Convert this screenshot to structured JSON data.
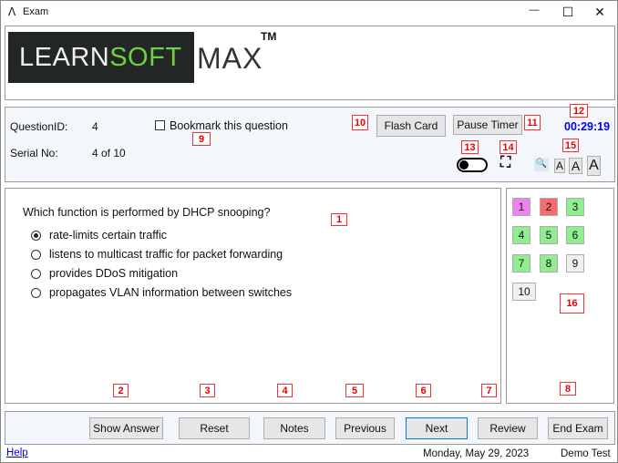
{
  "window": {
    "title": "Exam",
    "minimize": "—",
    "maximize": "☐",
    "close": "✕"
  },
  "logo": {
    "part1": "LEARN",
    "part2": "SOFT",
    "part3": "MAX",
    "tm": "TM"
  },
  "info": {
    "question_id_label": "QuestionID:",
    "question_id": "4",
    "serial_label": "Serial No:",
    "serial": "4 of 10",
    "bookmark_label": "Bookmark this question",
    "bookmark_checked": false,
    "flash_card": "Flash Card",
    "pause_timer": "Pause Timer",
    "timer": "00:29:19",
    "timer_color": "#0000ee",
    "font_sizes": [
      "A",
      "A",
      "A"
    ]
  },
  "question": {
    "text": "Which function is performed by DHCP snooping?",
    "options": [
      {
        "text": "rate-limits certain traffic",
        "selected": true
      },
      {
        "text": "listens to multicast traffic for packet forwarding",
        "selected": false
      },
      {
        "text": "provides DDoS mitigation",
        "selected": false
      },
      {
        "text": "propagates VLAN information between switches",
        "selected": false
      }
    ]
  },
  "navigator": [
    {
      "n": "1",
      "color": "#ee82ee"
    },
    {
      "n": "2",
      "color": "#f76b6b"
    },
    {
      "n": "3",
      "color": "#90ee90"
    },
    {
      "n": "4",
      "color": "#90ee90"
    },
    {
      "n": "5",
      "color": "#90ee90"
    },
    {
      "n": "6",
      "color": "#90ee90"
    },
    {
      "n": "7",
      "color": "#90ee90"
    },
    {
      "n": "8",
      "color": "#90ee90"
    },
    {
      "n": "9",
      "color": "#f0f0f0"
    },
    {
      "n": "10",
      "color": "#f0f0f0"
    }
  ],
  "buttons": {
    "show_answer": "Show Answer",
    "reset": "Reset",
    "notes": "Notes",
    "previous": "Previous",
    "next": "Next",
    "review": "Review",
    "end_exam": "End Exam"
  },
  "status": {
    "help": "Help",
    "date": "Monday, May 29, 2023",
    "mode": "Demo Test"
  },
  "markers": [
    "1",
    "2",
    "3",
    "4",
    "5",
    "6",
    "7",
    "8",
    "9",
    "10",
    "11",
    "12",
    "13",
    "14",
    "15",
    "16"
  ]
}
